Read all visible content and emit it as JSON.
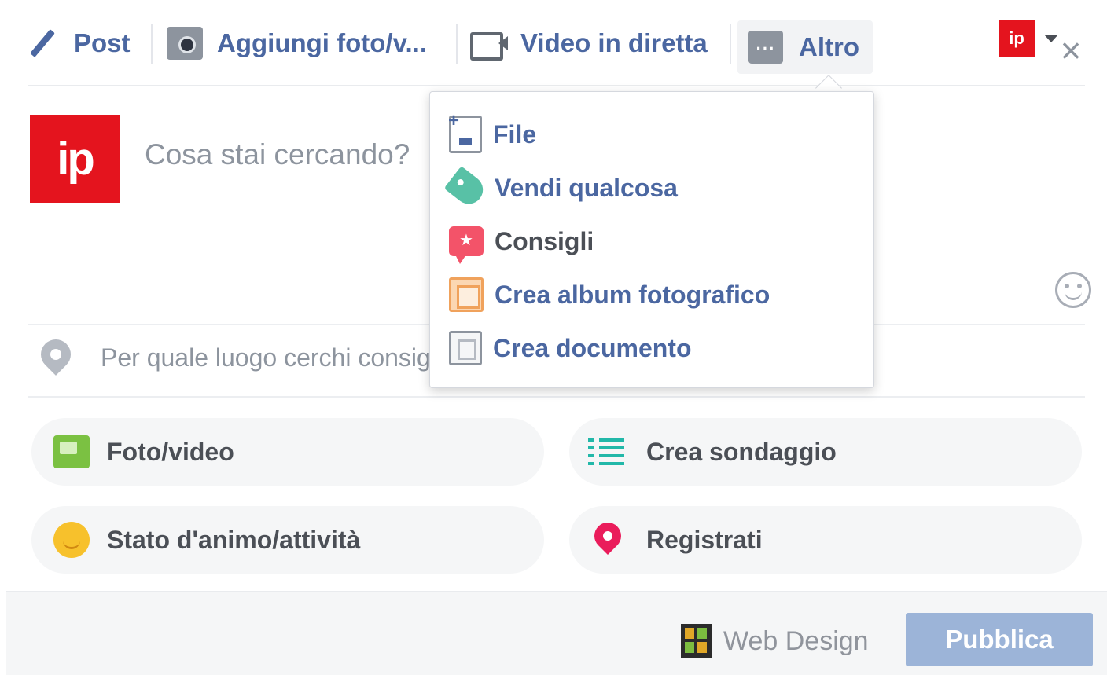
{
  "tabs": {
    "post": "Post",
    "add_photo": "Aggiungi foto/v...",
    "live_video": "Video in diretta",
    "more": "Altro"
  },
  "more_icon_glyph": "···",
  "top_avatar_glyph": "ip",
  "close_glyph": "×",
  "composer": {
    "avatar_glyph": "ip",
    "placeholder": "Cosa stai cercando?"
  },
  "location": {
    "placeholder": "Per quale luogo cerchi consigli?"
  },
  "actions": {
    "photo_video": "Foto/video",
    "poll": "Crea sondaggio",
    "mood": "Stato d'animo/attività",
    "checkin": "Registrati"
  },
  "dropdown": {
    "items": [
      {
        "label": "File",
        "icon": "file-upload-icon"
      },
      {
        "label": "Vendi qualcosa",
        "icon": "tag-icon"
      },
      {
        "label": "Consigli",
        "icon": "recommendation-bubble-icon"
      },
      {
        "label": "Crea album fotografico",
        "icon": "photo-album-icon"
      },
      {
        "label": "Crea documento",
        "icon": "document-icon"
      }
    ]
  },
  "footer": {
    "audience": "Web Design",
    "publish": "Pubblica"
  },
  "colors": {
    "link_blue": "#4b67a1",
    "brand_red": "#e4141e",
    "publish_disabled": "#9cb4d8",
    "pill_bg": "#f5f6f7"
  }
}
